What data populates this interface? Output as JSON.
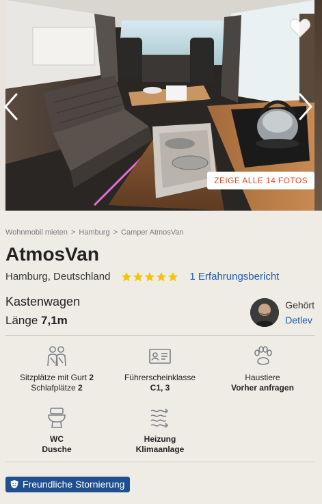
{
  "gallery": {
    "show_all_label": "ZEIGE ALLE 14 FOTOS",
    "favorite_icon": "heart-icon",
    "prev_icon": "chevron-left-icon",
    "next_icon": "chevron-right-icon"
  },
  "breadcrumb": {
    "items": [
      "Wohnmobil mieten",
      "Hamburg",
      "Camper AtmosVan"
    ],
    "separator": ">"
  },
  "listing": {
    "title": "AtmosVan",
    "location": "Hamburg, Deutschland",
    "rating_stars": 5,
    "reviews_label": "1 Erfahrungsbericht",
    "vehicle_type": "Kastenwagen",
    "length_label": "Länge",
    "length_value": "7,1m"
  },
  "owner": {
    "label": "Gehört",
    "name": "Detlev"
  },
  "features": [
    {
      "icon": "seats-icon",
      "line1_label": "Sitzplätze mit Gurt",
      "line1_value": "2",
      "line2_label": "Schlafplätze",
      "line2_value": "2"
    },
    {
      "icon": "license-icon",
      "line1_label": "Führerscheinklasse",
      "line2_value": "C1, 3"
    },
    {
      "icon": "paw-icon",
      "line1_label": "Haustiere",
      "line2_value": "Vorher anfragen"
    },
    {
      "icon": "toilet-icon",
      "line1_value": "WC",
      "line2_value": "Dusche"
    },
    {
      "icon": "heating-icon",
      "line1_value": "Heizung",
      "line2_value": "Klimaanlage"
    }
  ],
  "cancellation_badge": "Freundliche Stornierung",
  "colors": {
    "accent_blue": "#1f5aa8",
    "badge_blue": "#1f4f91",
    "photo_button_text": "#e0472a",
    "star_yellow": "#f2c20d",
    "background": "#efece6"
  }
}
